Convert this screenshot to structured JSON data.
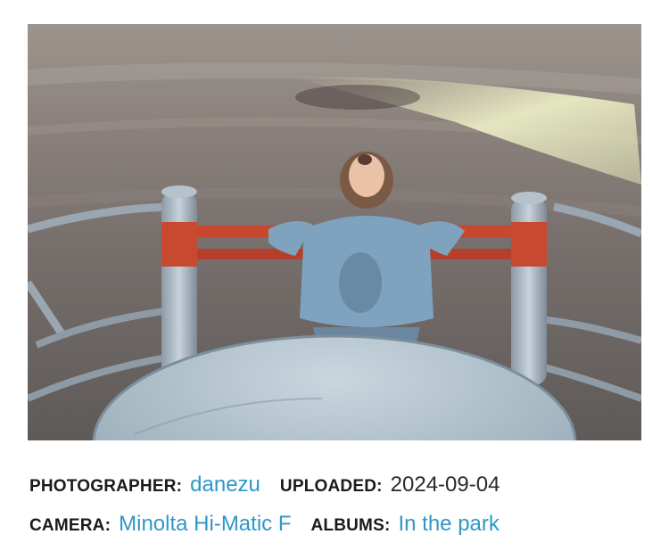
{
  "photo": {
    "alt_label": ""
  },
  "metadata": {
    "photographer_label": "PHOTOGRAPHER:",
    "photographer_value": "danezu",
    "uploaded_label": "UPLOADED:",
    "uploaded_value": "2024-09-04",
    "camera_label": "CAMERA:",
    "camera_value": "Minolta Hi-Matic F",
    "albums_label": "ALBUMS:",
    "albums_value": "In the park"
  },
  "colors": {
    "link": "#2f97c8",
    "label": "#1a1a1a",
    "value": "#2a2a2a"
  }
}
